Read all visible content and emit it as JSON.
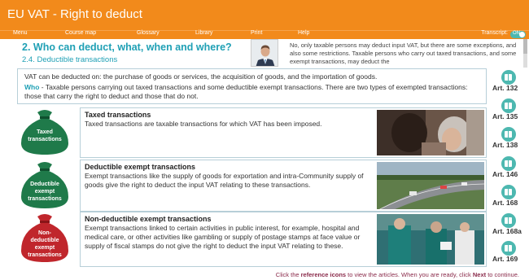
{
  "window": {
    "title": "EU VAT - Right to deduct"
  },
  "menu": {
    "items": [
      "Menu",
      "Course map",
      "Glossary",
      "Library",
      "Print",
      "Help"
    ],
    "transcript_label": "Transcript:",
    "toggle_label": "ON"
  },
  "section": {
    "heading": "2. Who can deduct, what, when and where?",
    "subheading": "2.4. Deductible transactions"
  },
  "transcript": {
    "text": "No, only taxable persons may deduct input VAT, but there are some exceptions, and also some restrictions. Taxable persons who carry out taxed transactions, and some exempt transactions, may deduct the"
  },
  "intro": {
    "line1": "VAT can be deducted on: the purchase of goods or services, the acquisition of goods, and the importation of goods.",
    "who_label": "Who",
    "who_text": " - Taxable persons carrying out taxed transactions and some deductible exempt transactions. There are two types of exempted transactions: those that carry the right to deduct and those that do not."
  },
  "categories": [
    {
      "bag_label_lines": [
        "Taxed",
        "transactions"
      ],
      "bag_color": "#1f7a4a",
      "title": "Taxed transactions",
      "text": "Taxed transactions are taxable transactions for which VAT has been imposed."
    },
    {
      "bag_label_lines": [
        "Deductible",
        "exempt",
        "transactions"
      ],
      "bag_color": "#1f7a4a",
      "title": "Deductible exempt transactions",
      "text": "Exempt transactions like the supply of goods for exportation and intra-Community supply of goods give the right to deduct the input VAT relating to these transactions."
    },
    {
      "bag_label_lines": [
        "Non-",
        "deductible",
        "exempt",
        "transactions"
      ],
      "bag_color": "#c0262c",
      "title": "Non-deductible exempt transactions",
      "text": "Exempt transactions linked to certain activities in public interest, for example, hospital and medical care, or other activities like gambling or supply of postage stamps at face value or supply of fiscal stamps do not give the right to deduct the input VAT relating to these."
    }
  ],
  "articles": [
    "Art. 132",
    "Art. 135",
    "Art. 138",
    "Art. 146",
    "Art. 168",
    "Art. 168a",
    "Art. 169"
  ],
  "footer": {
    "pre": "Click the ",
    "icons_bold": "reference icons",
    "mid": " to view the articles. When you are ready, click ",
    "next_bold": "Next",
    "post": " to continue."
  },
  "colors": {
    "orange": "#f28a1b",
    "teal": "#1fa0b5",
    "green_bag": "#1f7a4a",
    "red_bag": "#c0262c"
  }
}
